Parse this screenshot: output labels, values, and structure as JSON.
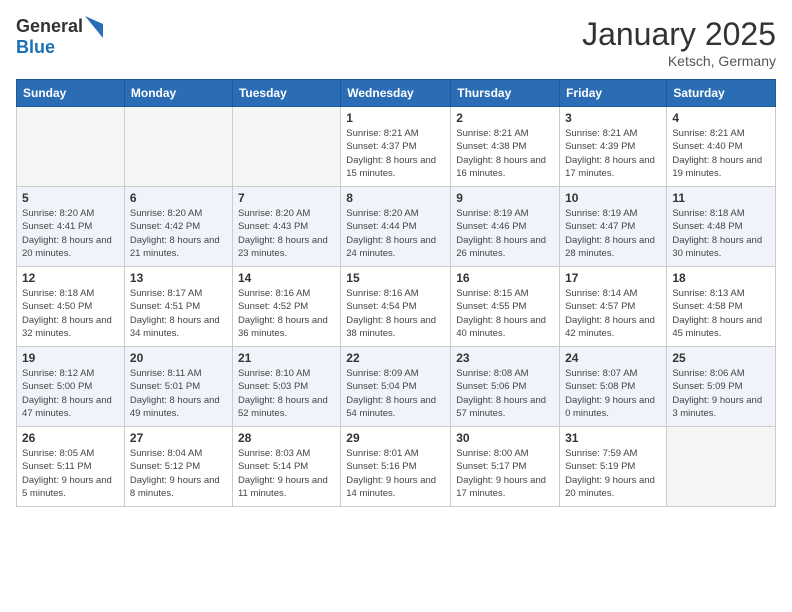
{
  "logo": {
    "general": "General",
    "blue": "Blue"
  },
  "title": "January 2025",
  "location": "Ketsch, Germany",
  "weekdays": [
    "Sunday",
    "Monday",
    "Tuesday",
    "Wednesday",
    "Thursday",
    "Friday",
    "Saturday"
  ],
  "weeks": [
    [
      {
        "day": "",
        "sunrise": "",
        "sunset": "",
        "daylight": ""
      },
      {
        "day": "",
        "sunrise": "",
        "sunset": "",
        "daylight": ""
      },
      {
        "day": "",
        "sunrise": "",
        "sunset": "",
        "daylight": ""
      },
      {
        "day": "1",
        "sunrise": "Sunrise: 8:21 AM",
        "sunset": "Sunset: 4:37 PM",
        "daylight": "Daylight: 8 hours and 15 minutes."
      },
      {
        "day": "2",
        "sunrise": "Sunrise: 8:21 AM",
        "sunset": "Sunset: 4:38 PM",
        "daylight": "Daylight: 8 hours and 16 minutes."
      },
      {
        "day": "3",
        "sunrise": "Sunrise: 8:21 AM",
        "sunset": "Sunset: 4:39 PM",
        "daylight": "Daylight: 8 hours and 17 minutes."
      },
      {
        "day": "4",
        "sunrise": "Sunrise: 8:21 AM",
        "sunset": "Sunset: 4:40 PM",
        "daylight": "Daylight: 8 hours and 19 minutes."
      }
    ],
    [
      {
        "day": "5",
        "sunrise": "Sunrise: 8:20 AM",
        "sunset": "Sunset: 4:41 PM",
        "daylight": "Daylight: 8 hours and 20 minutes."
      },
      {
        "day": "6",
        "sunrise": "Sunrise: 8:20 AM",
        "sunset": "Sunset: 4:42 PM",
        "daylight": "Daylight: 8 hours and 21 minutes."
      },
      {
        "day": "7",
        "sunrise": "Sunrise: 8:20 AM",
        "sunset": "Sunset: 4:43 PM",
        "daylight": "Daylight: 8 hours and 23 minutes."
      },
      {
        "day": "8",
        "sunrise": "Sunrise: 8:20 AM",
        "sunset": "Sunset: 4:44 PM",
        "daylight": "Daylight: 8 hours and 24 minutes."
      },
      {
        "day": "9",
        "sunrise": "Sunrise: 8:19 AM",
        "sunset": "Sunset: 4:46 PM",
        "daylight": "Daylight: 8 hours and 26 minutes."
      },
      {
        "day": "10",
        "sunrise": "Sunrise: 8:19 AM",
        "sunset": "Sunset: 4:47 PM",
        "daylight": "Daylight: 8 hours and 28 minutes."
      },
      {
        "day": "11",
        "sunrise": "Sunrise: 8:18 AM",
        "sunset": "Sunset: 4:48 PM",
        "daylight": "Daylight: 8 hours and 30 minutes."
      }
    ],
    [
      {
        "day": "12",
        "sunrise": "Sunrise: 8:18 AM",
        "sunset": "Sunset: 4:50 PM",
        "daylight": "Daylight: 8 hours and 32 minutes."
      },
      {
        "day": "13",
        "sunrise": "Sunrise: 8:17 AM",
        "sunset": "Sunset: 4:51 PM",
        "daylight": "Daylight: 8 hours and 34 minutes."
      },
      {
        "day": "14",
        "sunrise": "Sunrise: 8:16 AM",
        "sunset": "Sunset: 4:52 PM",
        "daylight": "Daylight: 8 hours and 36 minutes."
      },
      {
        "day": "15",
        "sunrise": "Sunrise: 8:16 AM",
        "sunset": "Sunset: 4:54 PM",
        "daylight": "Daylight: 8 hours and 38 minutes."
      },
      {
        "day": "16",
        "sunrise": "Sunrise: 8:15 AM",
        "sunset": "Sunset: 4:55 PM",
        "daylight": "Daylight: 8 hours and 40 minutes."
      },
      {
        "day": "17",
        "sunrise": "Sunrise: 8:14 AM",
        "sunset": "Sunset: 4:57 PM",
        "daylight": "Daylight: 8 hours and 42 minutes."
      },
      {
        "day": "18",
        "sunrise": "Sunrise: 8:13 AM",
        "sunset": "Sunset: 4:58 PM",
        "daylight": "Daylight: 8 hours and 45 minutes."
      }
    ],
    [
      {
        "day": "19",
        "sunrise": "Sunrise: 8:12 AM",
        "sunset": "Sunset: 5:00 PM",
        "daylight": "Daylight: 8 hours and 47 minutes."
      },
      {
        "day": "20",
        "sunrise": "Sunrise: 8:11 AM",
        "sunset": "Sunset: 5:01 PM",
        "daylight": "Daylight: 8 hours and 49 minutes."
      },
      {
        "day": "21",
        "sunrise": "Sunrise: 8:10 AM",
        "sunset": "Sunset: 5:03 PM",
        "daylight": "Daylight: 8 hours and 52 minutes."
      },
      {
        "day": "22",
        "sunrise": "Sunrise: 8:09 AM",
        "sunset": "Sunset: 5:04 PM",
        "daylight": "Daylight: 8 hours and 54 minutes."
      },
      {
        "day": "23",
        "sunrise": "Sunrise: 8:08 AM",
        "sunset": "Sunset: 5:06 PM",
        "daylight": "Daylight: 8 hours and 57 minutes."
      },
      {
        "day": "24",
        "sunrise": "Sunrise: 8:07 AM",
        "sunset": "Sunset: 5:08 PM",
        "daylight": "Daylight: 9 hours and 0 minutes."
      },
      {
        "day": "25",
        "sunrise": "Sunrise: 8:06 AM",
        "sunset": "Sunset: 5:09 PM",
        "daylight": "Daylight: 9 hours and 3 minutes."
      }
    ],
    [
      {
        "day": "26",
        "sunrise": "Sunrise: 8:05 AM",
        "sunset": "Sunset: 5:11 PM",
        "daylight": "Daylight: 9 hours and 5 minutes."
      },
      {
        "day": "27",
        "sunrise": "Sunrise: 8:04 AM",
        "sunset": "Sunset: 5:12 PM",
        "daylight": "Daylight: 9 hours and 8 minutes."
      },
      {
        "day": "28",
        "sunrise": "Sunrise: 8:03 AM",
        "sunset": "Sunset: 5:14 PM",
        "daylight": "Daylight: 9 hours and 11 minutes."
      },
      {
        "day": "29",
        "sunrise": "Sunrise: 8:01 AM",
        "sunset": "Sunset: 5:16 PM",
        "daylight": "Daylight: 9 hours and 14 minutes."
      },
      {
        "day": "30",
        "sunrise": "Sunrise: 8:00 AM",
        "sunset": "Sunset: 5:17 PM",
        "daylight": "Daylight: 9 hours and 17 minutes."
      },
      {
        "day": "31",
        "sunrise": "Sunrise: 7:59 AM",
        "sunset": "Sunset: 5:19 PM",
        "daylight": "Daylight: 9 hours and 20 minutes."
      },
      {
        "day": "",
        "sunrise": "",
        "sunset": "",
        "daylight": ""
      }
    ]
  ]
}
